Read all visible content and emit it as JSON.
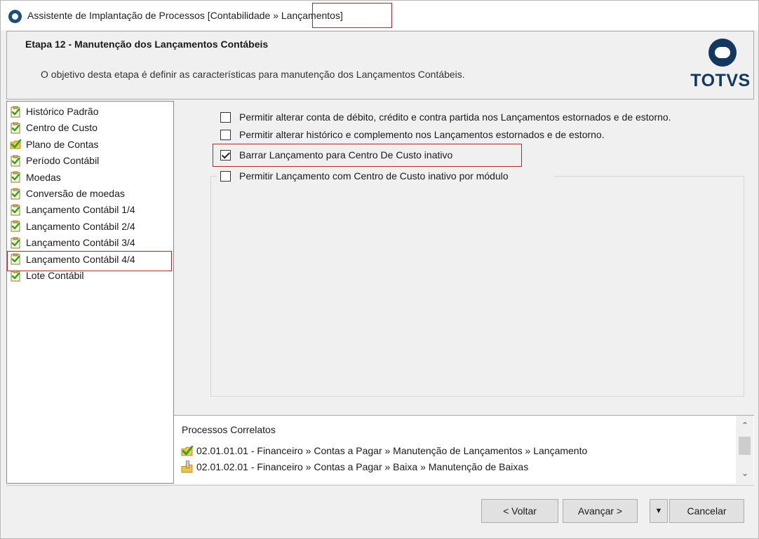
{
  "window": {
    "title_prefix": "Assistente de Implantação de Processos [Contabilidade »",
    "title_highlight": "Lançamentos]"
  },
  "header": {
    "step_title": "Etapa 12 - Manutenção dos Lançamentos Contábeis",
    "step_description": "O objetivo desta etapa é definir as características para manutenção dos Lançamentos Contábeis.",
    "logo_text": "TOTVS"
  },
  "sidebar": {
    "items": [
      {
        "label": "Histórico Padrão",
        "icon": "check-document-icon"
      },
      {
        "label": "Centro de Custo",
        "icon": "check-document-icon"
      },
      {
        "label": "Plano de Contas",
        "icon": "check-folder-icon"
      },
      {
        "label": "Período Contábil",
        "icon": "check-document-icon"
      },
      {
        "label": "Moedas",
        "icon": "check-document-icon"
      },
      {
        "label": "Conversão de moedas",
        "icon": "check-document-icon"
      },
      {
        "label": "Lançamento Contábil 1/4",
        "icon": "check-document-icon"
      },
      {
        "label": "Lançamento Contábil 2/4",
        "icon": "check-document-icon"
      },
      {
        "label": "Lançamento Contábil 3/4",
        "icon": "check-document-icon"
      },
      {
        "label": "Lançamento Contábil 4/4",
        "icon": "check-document-icon"
      },
      {
        "label": "Lote Contábil",
        "icon": "check-document-icon"
      }
    ],
    "selected_index": 9
  },
  "options": [
    {
      "label": "Permitir alterar conta de débito, crédito e contra partida nos Lançamentos estornados e de estorno.",
      "checked": false
    },
    {
      "label": "Permitir alterar histórico e complemento nos Lançamentos estornados e de estorno.",
      "checked": false
    },
    {
      "label": "Barrar Lançamento para Centro De Custo inativo",
      "checked": true
    },
    {
      "label": "Permitir Lançamento com Centro de Custo inativo por módulo",
      "checked": false
    }
  ],
  "related": {
    "title": "Processos Correlatos",
    "items": [
      {
        "label": "02.01.01.01 - Financeiro » Contas a Pagar » Manutenção de Lançamentos » Lançamento",
        "icon": "check-folder-icon"
      },
      {
        "label": "02.01.02.01 - Financeiro » Contas a Pagar » Baixa » Manutenção de Baixas",
        "icon": "pencil-folder-icon"
      }
    ]
  },
  "buttons": {
    "back": "< Voltar",
    "next": "Avançar >",
    "cancel": "Cancelar"
  },
  "colors": {
    "highlight": "#a32a2a",
    "brand": "#14375e",
    "check_green": "#2e9e2e"
  }
}
